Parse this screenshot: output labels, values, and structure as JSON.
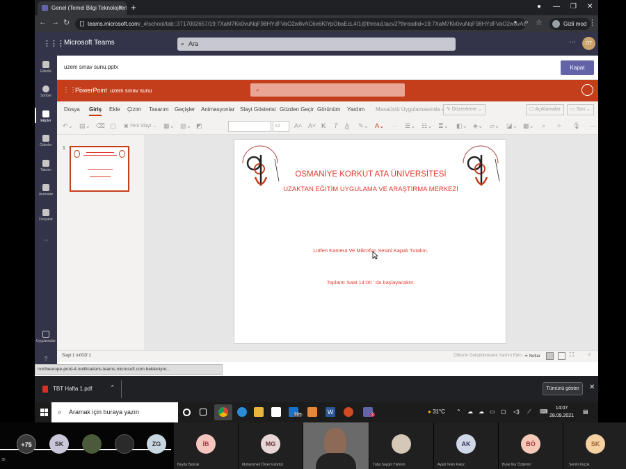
{
  "browser": {
    "tab_title": "Genel (Temel Bilgi Teknolojileri) |",
    "url_host": "teams.microsoft.com",
    "url_path": "/_#/school/tab::3717002657/19:7XaM7Kk0vuNqF98HYdFVaO2w8vAC6e6KIYpObaEcL4I1@thread.tacv2?threadId=19:7XaM7Kk0vuNqF98HYdFVaO2w8vAC6e6KIYpOb...",
    "incognito_label": "Gizli mod"
  },
  "teams": {
    "app_name": "Microsoft Teams",
    "search_placeholder": "Ara",
    "avatar_initials": "ÖT",
    "rail": [
      {
        "label": "Etkinlik",
        "icon": "bell-icon"
      },
      {
        "label": "Sohbet",
        "icon": "chat-icon"
      },
      {
        "label": "Ekipler",
        "icon": "teams-icon"
      },
      {
        "label": "Ödevler",
        "icon": "assignments-icon"
      },
      {
        "label": "Takvim",
        "icon": "calendar-icon"
      },
      {
        "label": "Aramalar",
        "icon": "phone-icon"
      },
      {
        "label": "Dosyalar",
        "icon": "files-icon"
      },
      {
        "label": "...",
        "icon": "more-icon"
      },
      {
        "label": "Uygulamalar",
        "icon": "apps-icon"
      },
      {
        "label": "?",
        "icon": "help-icon"
      }
    ],
    "file_name": "uzem sınav sunu.pptx",
    "close_label": "Kapat"
  },
  "ppt": {
    "app_name": "PowerPoint",
    "doc_name": "uzem sınav sunu",
    "menu": [
      "Dosya",
      "Giriş",
      "Ekle",
      "Çizim",
      "Tasarım",
      "Geçişler",
      "Animasyonlar",
      "Slayt Gösterisi",
      "Gözden Geçir",
      "Görünüm",
      "Yardım"
    ],
    "desktop_label": "Masaüstü Uygulamasında aç",
    "edit_mode": "Düzenleme",
    "comments": "Açıklamalar",
    "present": "Sun",
    "new_slide": "Yeni Slayt",
    "font_size": "12",
    "slide_number": "1",
    "slide": {
      "title1": "OSMANİYE KORKUT ATA ÜNİVERSİTESİ",
      "title2": "UZAKTAN EĞİTİM UYGULAMA VE ARAŞTIRMA MERKEZİ",
      "line1": "Lütfen Kamera Ve Mikrofon Sesini Kapalı Tutalım.",
      "line2": "Toplantı Saat  14:00 ' da başlayacaktır.",
      "logo_text": "OSMANİYE KORKUT ATA ÜNİVERSİTESİ"
    },
    "status": {
      "slide_pos": "Slayt 1 \\u002f 1",
      "help": "Office'in Geliştirilmesine Yardım Edin",
      "notes": "Notlar"
    },
    "notif_text": "northeurope-prod-4.notifications.teams.microsoft.com bekleniyor..."
  },
  "downloads": {
    "file": "TBT Hafta 1.pdf",
    "show_all": "Tümünü göster"
  },
  "taskbar": {
    "search_placeholder": "Aramak için buraya yazın",
    "mail_badge": "99+",
    "teams_badge": "2",
    "weather": "31°C",
    "time": "14:07",
    "date": "28.09.2021"
  },
  "participants": [
    {
      "initials": "+75",
      "color": "#3a3a3a"
    },
    {
      "initials": "SK",
      "color": "#c8c6d8"
    },
    {
      "initials": "",
      "color": "#4a5a3a"
    },
    {
      "initials": "",
      "color": "#2a2a2a"
    },
    {
      "initials": "ZG",
      "color": "#c8d6e0"
    },
    {
      "initials": "İB",
      "color": "#f5c6c0",
      "name": "Beyda Babrak"
    },
    {
      "initials": "MG",
      "color": "#e8d6d6",
      "name": "Muhammed Ömer Gündüz"
    },
    {
      "initials": "",
      "color": "#6a6a6a"
    },
    {
      "initials": "",
      "color": "#d6c8b8",
      "name": "Tuba Saygılı Yıldırım"
    },
    {
      "initials": "AK",
      "color": "#d0d8e8",
      "name": "Ayşül Tekin Kakız"
    },
    {
      "initials": "BÖ",
      "color": "#f5c8b8",
      "name": "Buse Nur Özdemir"
    },
    {
      "initials": "SK",
      "color": "#f5d0a0",
      "name": "Semih Küçük"
    }
  ],
  "corner_text": "35"
}
